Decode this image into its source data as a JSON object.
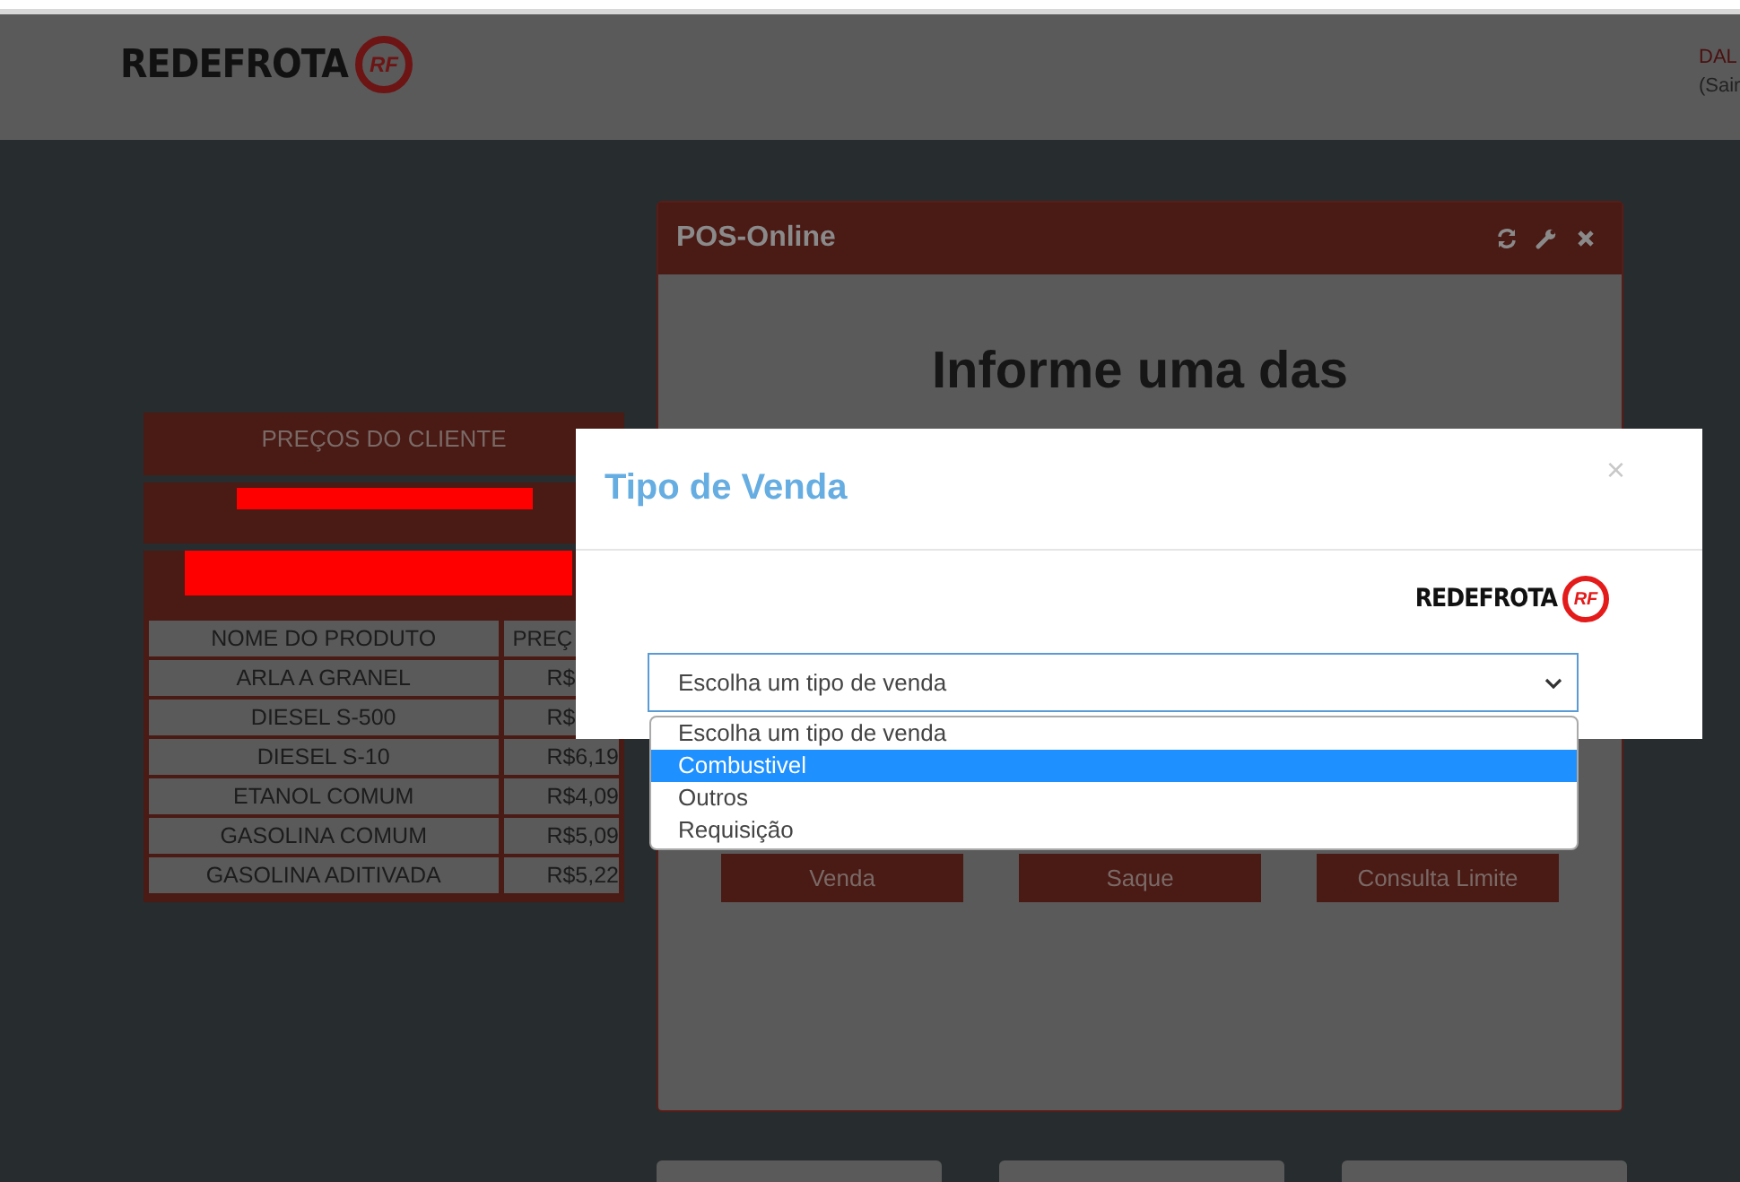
{
  "header": {
    "logo": {
      "wordmark": "REDEFROTA",
      "badge": "RF"
    },
    "user": {
      "name": "DAL",
      "logout": "(Sair"
    }
  },
  "prices_panel": {
    "title": "PREÇOS DO CLIENTE",
    "columns": [
      "NOME DO PRODUTO",
      "PREÇ"
    ],
    "rows": [
      {
        "product": "ARLA A GRANEL",
        "price": "R$"
      },
      {
        "product": "DIESEL S-500",
        "price": "R$"
      },
      {
        "product": "DIESEL S-10",
        "price": "R$6,19"
      },
      {
        "product": "ETANOL COMUM",
        "price": "R$4,09"
      },
      {
        "product": "GASOLINA COMUM",
        "price": "R$5,09"
      },
      {
        "product": "GASOLINA ADITIVADA",
        "price": "R$5,22"
      }
    ]
  },
  "pos_panel": {
    "title": "POS-Online",
    "heading": "Informe uma das",
    "buttons": [
      "Venda",
      "Saque",
      "Consulta Limite"
    ]
  },
  "modal": {
    "title": "Tipo de Venda",
    "close": "×",
    "logo": {
      "wordmark": "REDEFROTA",
      "badge": "RF"
    },
    "select": {
      "value": "Escolha um tipo de venda",
      "options": [
        {
          "label": "Escolha um tipo de venda",
          "highlighted": false
        },
        {
          "label": "Combustivel",
          "highlighted": true
        },
        {
          "label": "Outros",
          "highlighted": false
        },
        {
          "label": "Requisição",
          "highlighted": false
        }
      ]
    }
  }
}
